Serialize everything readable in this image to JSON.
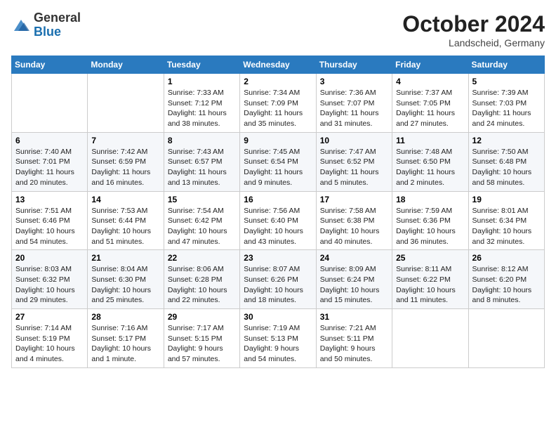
{
  "header": {
    "logo_general": "General",
    "logo_blue": "Blue",
    "month_title": "October 2024",
    "location": "Landscheid, Germany"
  },
  "weekdays": [
    "Sunday",
    "Monday",
    "Tuesday",
    "Wednesday",
    "Thursday",
    "Friday",
    "Saturday"
  ],
  "weeks": [
    [
      {
        "day": "",
        "sunrise": "",
        "sunset": "",
        "daylight": ""
      },
      {
        "day": "",
        "sunrise": "",
        "sunset": "",
        "daylight": ""
      },
      {
        "day": "1",
        "sunrise": "Sunrise: 7:33 AM",
        "sunset": "Sunset: 7:12 PM",
        "daylight": "Daylight: 11 hours and 38 minutes."
      },
      {
        "day": "2",
        "sunrise": "Sunrise: 7:34 AM",
        "sunset": "Sunset: 7:09 PM",
        "daylight": "Daylight: 11 hours and 35 minutes."
      },
      {
        "day": "3",
        "sunrise": "Sunrise: 7:36 AM",
        "sunset": "Sunset: 7:07 PM",
        "daylight": "Daylight: 11 hours and 31 minutes."
      },
      {
        "day": "4",
        "sunrise": "Sunrise: 7:37 AM",
        "sunset": "Sunset: 7:05 PM",
        "daylight": "Daylight: 11 hours and 27 minutes."
      },
      {
        "day": "5",
        "sunrise": "Sunrise: 7:39 AM",
        "sunset": "Sunset: 7:03 PM",
        "daylight": "Daylight: 11 hours and 24 minutes."
      }
    ],
    [
      {
        "day": "6",
        "sunrise": "Sunrise: 7:40 AM",
        "sunset": "Sunset: 7:01 PM",
        "daylight": "Daylight: 11 hours and 20 minutes."
      },
      {
        "day": "7",
        "sunrise": "Sunrise: 7:42 AM",
        "sunset": "Sunset: 6:59 PM",
        "daylight": "Daylight: 11 hours and 16 minutes."
      },
      {
        "day": "8",
        "sunrise": "Sunrise: 7:43 AM",
        "sunset": "Sunset: 6:57 PM",
        "daylight": "Daylight: 11 hours and 13 minutes."
      },
      {
        "day": "9",
        "sunrise": "Sunrise: 7:45 AM",
        "sunset": "Sunset: 6:54 PM",
        "daylight": "Daylight: 11 hours and 9 minutes."
      },
      {
        "day": "10",
        "sunrise": "Sunrise: 7:47 AM",
        "sunset": "Sunset: 6:52 PM",
        "daylight": "Daylight: 11 hours and 5 minutes."
      },
      {
        "day": "11",
        "sunrise": "Sunrise: 7:48 AM",
        "sunset": "Sunset: 6:50 PM",
        "daylight": "Daylight: 11 hours and 2 minutes."
      },
      {
        "day": "12",
        "sunrise": "Sunrise: 7:50 AM",
        "sunset": "Sunset: 6:48 PM",
        "daylight": "Daylight: 10 hours and 58 minutes."
      }
    ],
    [
      {
        "day": "13",
        "sunrise": "Sunrise: 7:51 AM",
        "sunset": "Sunset: 6:46 PM",
        "daylight": "Daylight: 10 hours and 54 minutes."
      },
      {
        "day": "14",
        "sunrise": "Sunrise: 7:53 AM",
        "sunset": "Sunset: 6:44 PM",
        "daylight": "Daylight: 10 hours and 51 minutes."
      },
      {
        "day": "15",
        "sunrise": "Sunrise: 7:54 AM",
        "sunset": "Sunset: 6:42 PM",
        "daylight": "Daylight: 10 hours and 47 minutes."
      },
      {
        "day": "16",
        "sunrise": "Sunrise: 7:56 AM",
        "sunset": "Sunset: 6:40 PM",
        "daylight": "Daylight: 10 hours and 43 minutes."
      },
      {
        "day": "17",
        "sunrise": "Sunrise: 7:58 AM",
        "sunset": "Sunset: 6:38 PM",
        "daylight": "Daylight: 10 hours and 40 minutes."
      },
      {
        "day": "18",
        "sunrise": "Sunrise: 7:59 AM",
        "sunset": "Sunset: 6:36 PM",
        "daylight": "Daylight: 10 hours and 36 minutes."
      },
      {
        "day": "19",
        "sunrise": "Sunrise: 8:01 AM",
        "sunset": "Sunset: 6:34 PM",
        "daylight": "Daylight: 10 hours and 32 minutes."
      }
    ],
    [
      {
        "day": "20",
        "sunrise": "Sunrise: 8:03 AM",
        "sunset": "Sunset: 6:32 PM",
        "daylight": "Daylight: 10 hours and 29 minutes."
      },
      {
        "day": "21",
        "sunrise": "Sunrise: 8:04 AM",
        "sunset": "Sunset: 6:30 PM",
        "daylight": "Daylight: 10 hours and 25 minutes."
      },
      {
        "day": "22",
        "sunrise": "Sunrise: 8:06 AM",
        "sunset": "Sunset: 6:28 PM",
        "daylight": "Daylight: 10 hours and 22 minutes."
      },
      {
        "day": "23",
        "sunrise": "Sunrise: 8:07 AM",
        "sunset": "Sunset: 6:26 PM",
        "daylight": "Daylight: 10 hours and 18 minutes."
      },
      {
        "day": "24",
        "sunrise": "Sunrise: 8:09 AM",
        "sunset": "Sunset: 6:24 PM",
        "daylight": "Daylight: 10 hours and 15 minutes."
      },
      {
        "day": "25",
        "sunrise": "Sunrise: 8:11 AM",
        "sunset": "Sunset: 6:22 PM",
        "daylight": "Daylight: 10 hours and 11 minutes."
      },
      {
        "day": "26",
        "sunrise": "Sunrise: 8:12 AM",
        "sunset": "Sunset: 6:20 PM",
        "daylight": "Daylight: 10 hours and 8 minutes."
      }
    ],
    [
      {
        "day": "27",
        "sunrise": "Sunrise: 7:14 AM",
        "sunset": "Sunset: 5:19 PM",
        "daylight": "Daylight: 10 hours and 4 minutes."
      },
      {
        "day": "28",
        "sunrise": "Sunrise: 7:16 AM",
        "sunset": "Sunset: 5:17 PM",
        "daylight": "Daylight: 10 hours and 1 minute."
      },
      {
        "day": "29",
        "sunrise": "Sunrise: 7:17 AM",
        "sunset": "Sunset: 5:15 PM",
        "daylight": "Daylight: 9 hours and 57 minutes."
      },
      {
        "day": "30",
        "sunrise": "Sunrise: 7:19 AM",
        "sunset": "Sunset: 5:13 PM",
        "daylight": "Daylight: 9 hours and 54 minutes."
      },
      {
        "day": "31",
        "sunrise": "Sunrise: 7:21 AM",
        "sunset": "Sunset: 5:11 PM",
        "daylight": "Daylight: 9 hours and 50 minutes."
      },
      {
        "day": "",
        "sunrise": "",
        "sunset": "",
        "daylight": ""
      },
      {
        "day": "",
        "sunrise": "",
        "sunset": "",
        "daylight": ""
      }
    ]
  ]
}
